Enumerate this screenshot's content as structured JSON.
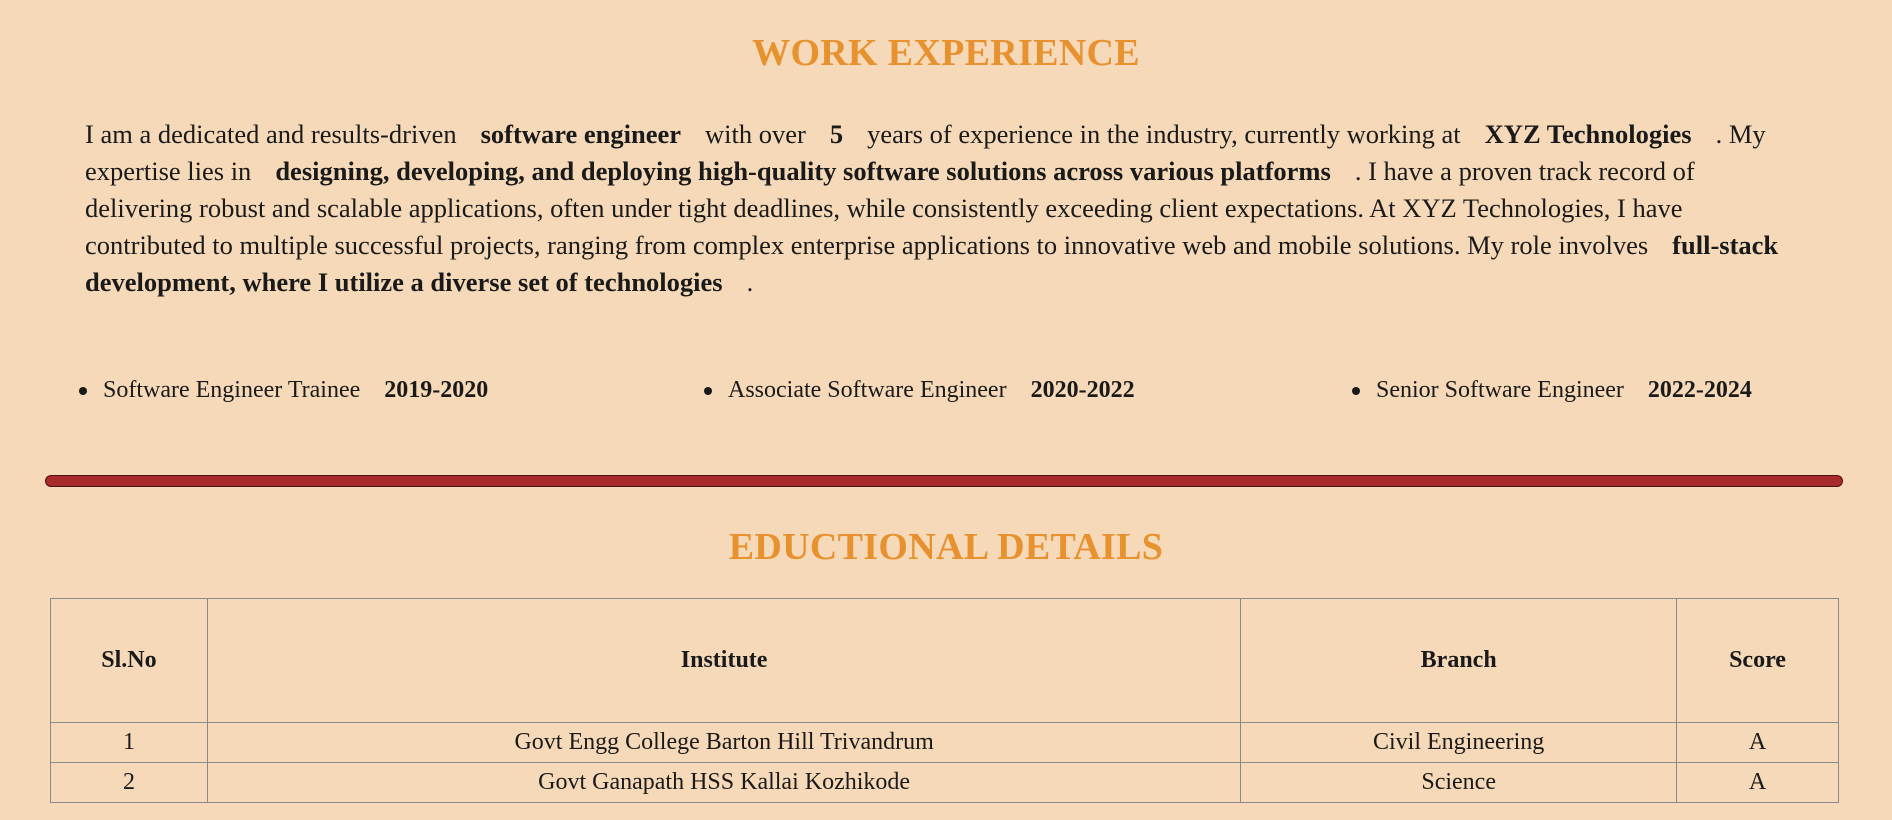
{
  "work": {
    "title": "WORK EXPERIENCE",
    "para": {
      "t1": "I am a dedicated and results-driven",
      "b1": "software engineer",
      "t2": "with over",
      "b2": "5",
      "t3": "years of experience in the industry, currently working at",
      "b3": "XYZ Technologies",
      "t4": ". My expertise lies in",
      "b4": "designing, developing, and deploying high-quality software solutions across various platforms",
      "t5": ". I have a proven track record of delivering robust and scalable applications, often under tight deadlines, while consistently exceeding client expectations. At XYZ Technologies, I have contributed to multiple successful projects, ranging from complex enterprise applications to innovative web and mobile solutions. My role involves",
      "b5": "full-stack development, where I utilize a diverse set of technologies",
      "t6": "."
    },
    "roles": [
      {
        "title": "Software Engineer Trainee",
        "years": "2019-2020"
      },
      {
        "title": "Associate Software Engineer",
        "years": "2020-2022"
      },
      {
        "title": "Senior Software Engineer",
        "years": "2022-2024"
      }
    ]
  },
  "education": {
    "title": "EDUCTIONAL DETAILS",
    "headers": [
      "Sl.No",
      "Institute",
      "Branch",
      "Score"
    ],
    "rows": [
      [
        "1",
        "Govt Engg College Barton Hill Trivandrum",
        "Civil Engineering",
        "A"
      ],
      [
        "2",
        "Govt Ganapath HSS Kallai Kozhikode",
        "Science",
        "A"
      ]
    ]
  },
  "colors": {
    "background": "#f5d9b8",
    "heading": "#e8912f",
    "divider": "#a82a2a"
  }
}
